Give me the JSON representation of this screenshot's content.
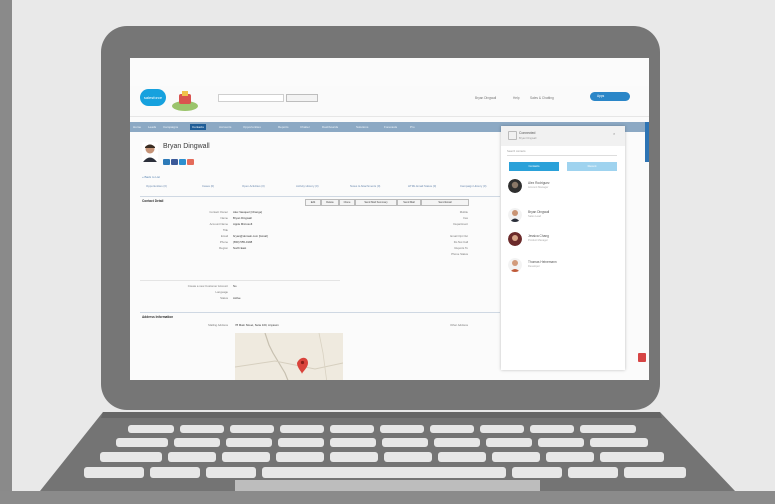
{
  "screen": {
    "search_placeholder": "Search...",
    "search_button": "Search",
    "header_links": [
      "Bryan Dingwall",
      "Help",
      "Sales & Chatting"
    ],
    "apps_button": "Apps",
    "tabs": [
      "Home",
      "Leads",
      "Campaigns",
      "Contacts",
      "Accounts",
      "Opportunities",
      "Reports",
      "Chatter",
      "Dashboards",
      "Solutions",
      "Forecasts",
      "Pro"
    ],
    "active_tab": "Contacts",
    "record": {
      "name": "Bryan Dingwall",
      "back_link": "« Back to List",
      "related_links": [
        "Opportunities (0)",
        "Cases (0)",
        "Open Activities (0)",
        "Activity History (0)",
        "Notes & Attachments (0)",
        "HTML Email Status (0)",
        "Campaign History (0)",
        "Contact Roles (0)"
      ],
      "section_title": "Contact Detail",
      "buttons": [
        "Edit",
        "Delete",
        "Clone",
        "Send Mail Summary",
        "Send Mail",
        "Send Email"
      ],
      "fields_left": [
        {
          "label": "Contact Owner",
          "value": "Alex Vasquez [Change]"
        },
        {
          "label": "Name",
          "value": "Bryan Dingwall"
        },
        {
          "label": "Account Name",
          "value": "Apple Microsoft"
        },
        {
          "label": "Title",
          "value": ""
        },
        {
          "label": "Email",
          "value": "bryan@domain.com [Gmail]"
        },
        {
          "label": "Phone",
          "value": "(650) 555-0198"
        },
        {
          "label": "Region",
          "value": "North East"
        }
      ],
      "fields_right": [
        {
          "label": "Mobile",
          "value": ""
        },
        {
          "label": "Fax",
          "value": ""
        },
        {
          "label": "Department",
          "value": ""
        },
        {
          "label": "Email Opt Out",
          "value": ""
        },
        {
          "label": "Do Not Call",
          "value": ""
        },
        {
          "label": "Reports To",
          "value": ""
        },
        {
          "label": "Phone Status",
          "value": ""
        }
      ],
      "extra_fields": [
        {
          "label": "Create a new Customer Account",
          "value": "No"
        },
        {
          "label": "Language",
          "value": ""
        },
        {
          "label": "Status",
          "value": "Active"
        }
      ],
      "address_section": "Address Information",
      "mailing_label": "Mailing Address",
      "mailing_value": "78 Main Street, Suite 100, Anytown",
      "other_label": "Other Address"
    },
    "panel": {
      "title": "Connected",
      "subtitle": "Bryan Dingwall",
      "search_placeholder": "Search contacts",
      "tabs": [
        "Contacts",
        "Recent"
      ],
      "contacts": [
        {
          "name": "Alex Rodriguez",
          "title": "Account Manager"
        },
        {
          "name": "Bryan Dingwall",
          "title": "Sales Lead"
        },
        {
          "name": "Jessica Chang",
          "title": "Product Manager"
        },
        {
          "name": "Thomas Heinemann",
          "title": "Developer"
        }
      ]
    }
  },
  "colors": {
    "bezel": "#767676",
    "accent": "#2aa1d9",
    "tab_bar": "#8ca9c4"
  }
}
